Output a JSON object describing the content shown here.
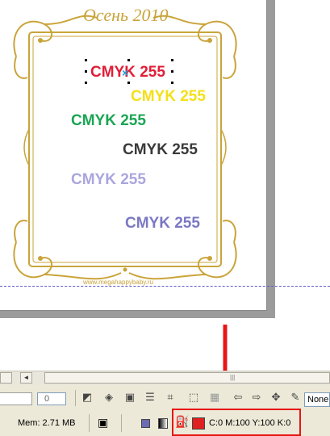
{
  "colors": {
    "gold": "#c9a43a",
    "red": "#e01e37",
    "yellow": "#f4e01a",
    "green": "#1aa654",
    "dark_gray": "#3a3a3a",
    "lavender": "#a9a6de",
    "violet": "#7b78c4",
    "highlight_red": "#e81515",
    "current_fill": "#e02020"
  },
  "canvas": {
    "page_title": "Осень 2010",
    "texts": [
      "CMYK 255",
      "CMYK 255",
      "CMYK 255",
      "CMYK 255",
      "CMYK 255",
      "CMYK 255"
    ],
    "selected_text": "CMYK 255",
    "url": "www.megahappybaby.ru"
  },
  "toolbar": {
    "spin_value": "0",
    "outline_value": "None",
    "icons": [
      "interactive-fill-icon",
      "mesh-fill-icon",
      "contour-icon",
      "align-icon",
      "node-edit-icon",
      "shape-icon",
      "weld-icon",
      "arrow-left-icon",
      "arrow-right-icon",
      "move-icon",
      "pen-icon"
    ]
  },
  "status": {
    "memory": "Mem: 2.71 MB",
    "color_readout": "C:0 M:100 Y:100 K:0"
  }
}
